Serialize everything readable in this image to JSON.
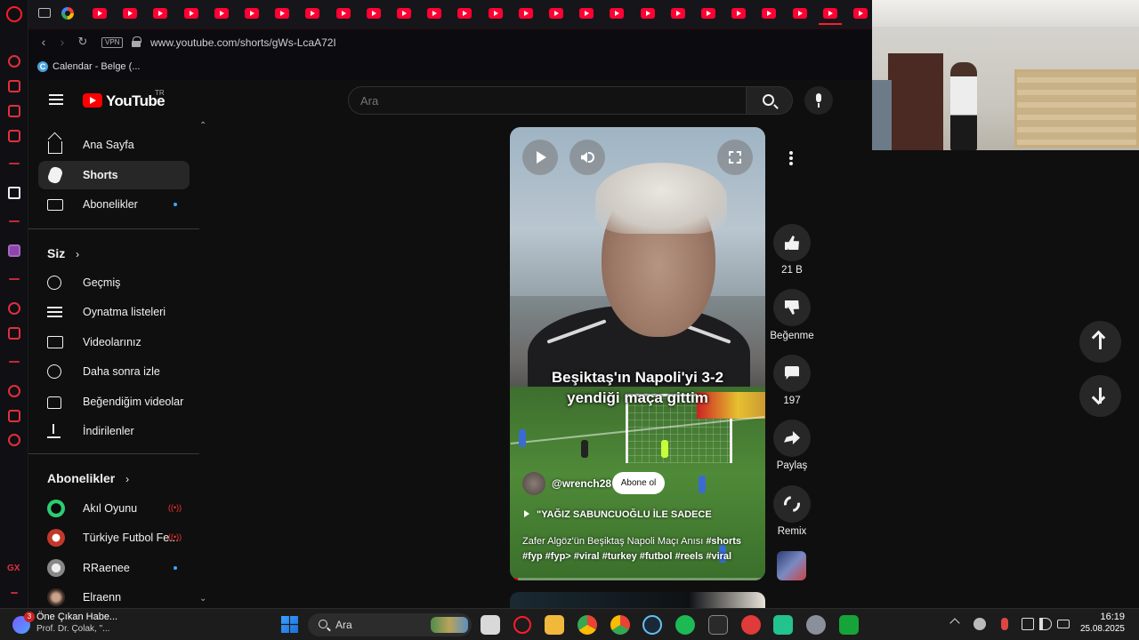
{
  "browser": {
    "url": "www.youtube.com/shorts/gWs-LcaA72I",
    "vpn_label": "VPN",
    "bookmark_label": "Calendar - Belge (...",
    "bookmark_icon_letter": "C"
  },
  "youtube": {
    "logo_text": "YouTube",
    "country_code": "TR",
    "search_placeholder": "Ara",
    "accent_color": "#ff0000"
  },
  "sidebar": {
    "main_items": [
      {
        "label": "Ana Sayfa",
        "icon": "home-icon"
      },
      {
        "label": "Shorts",
        "icon": "shorts-icon",
        "active": true
      },
      {
        "label": "Abonelikler",
        "icon": "subscriptions-icon",
        "has_new": true
      }
    ],
    "you_section_title": "Siz",
    "you_items": [
      {
        "label": "Geçmiş",
        "icon": "history-icon"
      },
      {
        "label": "Oynatma listeleri",
        "icon": "playlists-icon"
      },
      {
        "label": "Videolarınız",
        "icon": "your-videos-icon"
      },
      {
        "label": "Daha sonra izle",
        "icon": "watch-later-icon"
      },
      {
        "label": "Beğendiğim videolar",
        "icon": "liked-videos-icon"
      },
      {
        "label": "İndirilenler",
        "icon": "downloads-icon"
      }
    ],
    "subs_section_title": "Abonelikler",
    "subscriptions": [
      {
        "label": "Akıl Oyunu",
        "status": "live",
        "live_glyph": "((•))"
      },
      {
        "label": "Türkiye Futbol Fe...",
        "status": "live",
        "live_glyph": "((•))"
      },
      {
        "label": "RRaenee",
        "status": "new"
      },
      {
        "label": "Elraenn",
        "status": "none"
      }
    ]
  },
  "short": {
    "overlay_line1": "Beşiktaş'ın Napoli'yi 3-2",
    "overlay_line2": "yendiği maça gittim",
    "channel": "@wrench28",
    "subscribe_label": "Abone ol",
    "music": "\"YAĞIZ SABUNCUOĞLU İLE SADECE",
    "description_text": "Zafer Algöz'ün Beşiktaş Napoli Maçı Anısı ",
    "hashtags": "#shorts #fyp #fyp> #viral #turkey #futbol #reels #viral",
    "progress_fraction": 0.03
  },
  "actions": {
    "like_count": "21 B",
    "dislike_label": "Beğenme",
    "comment_count": "197",
    "share_label": "Paylaş",
    "remix_label": "Remix"
  },
  "taskbar": {
    "news_badge": "3",
    "news_title": "Öne Çıkan Habe...",
    "news_subtitle": "Prof. Dr. Çolak, \"...",
    "search_label": "Ara",
    "time": "16:19",
    "date": "25.08.2025"
  },
  "opera_rail": {
    "gx_label": "GX"
  }
}
